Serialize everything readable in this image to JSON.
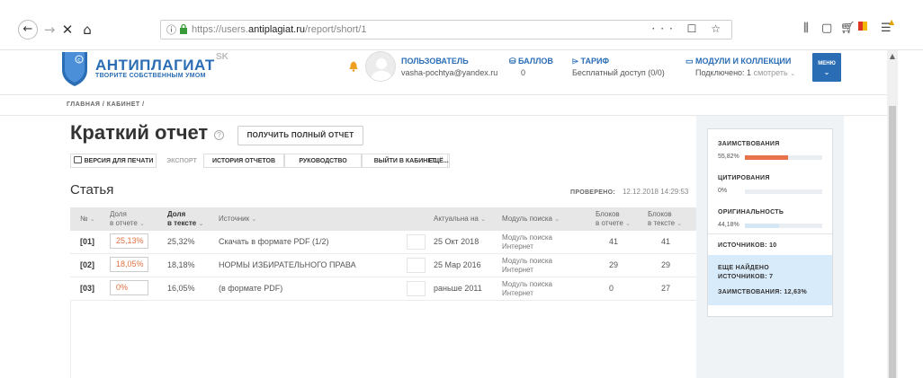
{
  "browser": {
    "url_prefix": "https://users.",
    "url_domain": "antiplagiat.ru",
    "url_path": "/report/short/1",
    "url_actions": "··· ☐ ☆"
  },
  "header": {
    "logo_part1": "АНТИ",
    "logo_part2": "ПЛАГИАТ",
    "logo_tagline": "ТВОРИТЕ СОБСТВЕННЫМ УМОМ",
    "logo_sk": "SK",
    "user_label": "ПОЛЬЗОВАТЕЛЬ",
    "user_email": "vasha-pochtya@yandex.ru",
    "points_label": "БАЛЛОВ",
    "points_value": "0",
    "tariff_label": "ТАРИФ",
    "tariff_value": "Бесплатный доступ (0/0)",
    "modules_label": "МОДУЛИ И КОЛЛЕКЦИИ",
    "modules_value": "Подключено: 1",
    "modules_link": "смотреть",
    "menu_label": "МЕНЮ"
  },
  "breadcrumb": "ГЛАВНАЯ  /  КАБИНЕТ  /",
  "page": {
    "title": "Краткий отчет",
    "help": "?",
    "full_report_button": "ПОЛУЧИТЬ ПОЛНЫЙ ОТЧЕТ",
    "section_title": "Статья",
    "checked_label": "ПРОВЕРЕНО:",
    "checked_value": "12.12.2018 14:29:53"
  },
  "toolbar": {
    "print": "ВЕРСИЯ ДЛЯ ПЕЧАТИ",
    "export": "ЭКСПОРТ",
    "history": "ИСТОРИЯ ОТЧЕТОВ",
    "guide": "РУКОВОДСТВО",
    "exit": "ВЫЙТИ В КАБИНЕТ",
    "more": "ЕЩЁ..."
  },
  "table": {
    "headers": {
      "num": "№",
      "share_report_1": "Доля",
      "share_report_2": "в отчете",
      "share_text_1": "Доля",
      "share_text_2": "в тексте",
      "source": "Источник",
      "actual": "Актуальна на",
      "module": "Модуль поиска",
      "blocks_report_1": "Блоков",
      "blocks_report_2": "в отчете",
      "blocks_text_1": "Блоков",
      "blocks_text_2": "в тексте"
    },
    "rows": [
      {
        "num": "[01]",
        "share_report": "25,13%",
        "share_text": "25,32%",
        "source": "Скачать в формате PDF (1/2)",
        "date": "25 Окт 2018",
        "module_1": "Модуль поиска",
        "module_2": "Интернет",
        "blocks_report": "41",
        "blocks_text": "41"
      },
      {
        "num": "[02]",
        "share_report": "18,05%",
        "share_text": "18,18%",
        "source": "НОРМЫ ИЗБИРАТЕЛЬНОГО ПРАВА",
        "date": "25 Мар 2016",
        "module_1": "Модуль поиска",
        "module_2": "Интернет",
        "blocks_report": "29",
        "blocks_text": "29"
      },
      {
        "num": "[03]",
        "share_report": "0%",
        "share_text": "16,05%",
        "source": "(в формате PDF)",
        "date": "раньше 2011",
        "module_1": "Модуль поиска",
        "module_2": "Интернет",
        "blocks_report": "0",
        "blocks_text": "27"
      }
    ]
  },
  "stats": {
    "borrow_label": "ЗАИМСТВОВАНИЯ",
    "borrow_value": "55,82%",
    "borrow_fraction": 0.5582,
    "borrow_color": "#e8734a",
    "cite_label": "ЦИТИРОВАНИЯ",
    "cite_value": "0%",
    "cite_fraction": 0,
    "orig_label": "ОРИГИНАЛЬНОСТЬ",
    "orig_value": "44,18%",
    "orig_fraction": 0.4418,
    "orig_color": "#d5e6f5",
    "sources_label": "ИСТОЧНИКОВ: 10",
    "found_title_1": "ЕЩЕ НАЙДЕНО",
    "found_title_2": "ИСТОЧНИКОВ: 7",
    "found_borrow": "ЗАИМСТВОВАНИЯ: 12,63%"
  }
}
